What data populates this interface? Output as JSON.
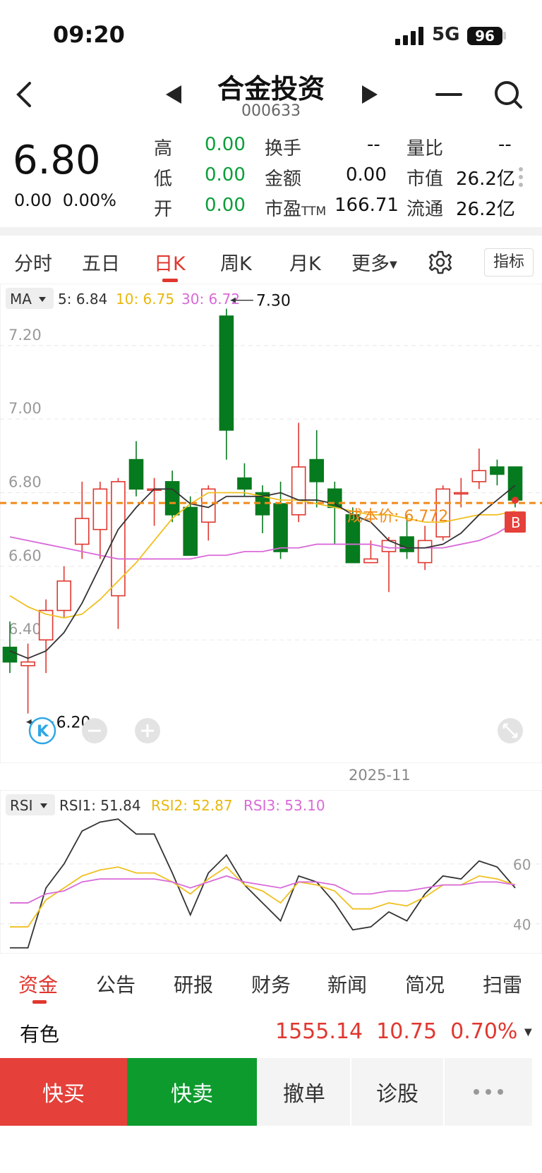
{
  "status": {
    "time": "09:20",
    "network": "5G",
    "battery": "96"
  },
  "nav": {
    "name": "合金投资",
    "code": "000633"
  },
  "quote": {
    "price": "6.80",
    "change": "0.00",
    "change_pct": "0.00%",
    "grid": [
      [
        {
          "k": "高",
          "v": "0.00"
        },
        {
          "k": "换手",
          "v": "--"
        },
        {
          "k": "量比",
          "v": "--"
        }
      ],
      [
        {
          "k": "低",
          "v": "0.00"
        },
        {
          "k": "金额",
          "v": "0.00"
        },
        {
          "k": "市值",
          "v": "26.2亿"
        }
      ],
      [
        {
          "k": "开",
          "v": "0.00"
        },
        {
          "k": "市盈",
          "sub": "TTM",
          "v": "166.71"
        },
        {
          "k": "流通",
          "v": "26.2亿"
        }
      ]
    ]
  },
  "tabs": [
    "分时",
    "五日",
    "日K",
    "周K",
    "月K",
    "更多"
  ],
  "active_tab": "日K",
  "indicator_btn": "指标",
  "ma_legend": {
    "selector": "MA",
    "ma5": "5: 6.84",
    "ma10": "10: 6.75",
    "ma30": "30: 6.72"
  },
  "chart_annotations": {
    "high": "7.30",
    "low": "6.20",
    "cost": "成本价: 6.772",
    "buy_marker": "B",
    "k_marker": "K"
  },
  "date_label": "2025-11",
  "rsi_legend": {
    "selector": "RSI",
    "rsi1": "RSI1: 51.84",
    "rsi2": "RSI2: 52.87",
    "rsi3": "RSI3: 53.10"
  },
  "colors": {
    "up": "#e0372f",
    "down": "#067a1e",
    "ma5": "#333333",
    "ma10": "#f0c020",
    "ma30": "#d96ad9",
    "cost": "#f08a1c"
  },
  "chart_data": [
    {
      "type": "candlestick",
      "y_ticks": [
        "7.20",
        "7.00",
        "6.80",
        "6.60",
        "6.40"
      ],
      "ylim": [
        6.18,
        7.33
      ],
      "candles": [
        {
          "o": 6.38,
          "c": 6.34,
          "h": 6.45,
          "l": 6.31
        },
        {
          "o": 6.33,
          "c": 6.34,
          "h": 6.39,
          "l": 6.2
        },
        {
          "o": 6.4,
          "c": 6.48,
          "h": 6.51,
          "l": 6.31
        },
        {
          "o": 6.48,
          "c": 6.56,
          "h": 6.6,
          "l": 6.46
        },
        {
          "o": 6.66,
          "c": 6.73,
          "h": 6.83,
          "l": 6.62
        },
        {
          "o": 6.7,
          "c": 6.81,
          "h": 6.83,
          "l": 6.62
        },
        {
          "o": 6.52,
          "c": 6.83,
          "h": 6.84,
          "l": 6.43
        },
        {
          "o": 6.89,
          "c": 6.81,
          "h": 6.94,
          "l": 6.79
        },
        {
          "o": 6.81,
          "c": 6.81,
          "h": 6.84,
          "l": 6.71
        },
        {
          "o": 6.83,
          "c": 6.74,
          "h": 6.86,
          "l": 6.72
        },
        {
          "o": 6.76,
          "c": 6.63,
          "h": 6.79,
          "l": 6.63
        },
        {
          "o": 6.72,
          "c": 6.81,
          "h": 6.82,
          "l": 6.67
        },
        {
          "o": 7.28,
          "c": 6.97,
          "h": 7.3,
          "l": 6.89
        },
        {
          "o": 6.84,
          "c": 6.81,
          "h": 6.88,
          "l": 6.79
        },
        {
          "o": 6.8,
          "c": 6.74,
          "h": 6.82,
          "l": 6.69
        },
        {
          "o": 6.77,
          "c": 6.64,
          "h": 6.83,
          "l": 6.62
        },
        {
          "o": 6.74,
          "c": 6.87,
          "h": 6.99,
          "l": 6.72
        },
        {
          "o": 6.89,
          "c": 6.83,
          "h": 6.97,
          "l": 6.76
        },
        {
          "o": 6.81,
          "c": 6.76,
          "h": 6.83,
          "l": 6.66
        },
        {
          "o": 6.74,
          "c": 6.61,
          "h": 6.76,
          "l": 6.61
        },
        {
          "o": 6.61,
          "c": 6.62,
          "h": 6.67,
          "l": 6.61
        },
        {
          "o": 6.64,
          "c": 6.67,
          "h": 6.68,
          "l": 6.53
        },
        {
          "o": 6.68,
          "c": 6.64,
          "h": 6.74,
          "l": 6.62
        },
        {
          "o": 6.61,
          "c": 6.67,
          "h": 6.71,
          "l": 6.59
        },
        {
          "o": 6.68,
          "c": 6.81,
          "h": 6.82,
          "l": 6.67
        },
        {
          "o": 6.8,
          "c": 6.8,
          "h": 6.84,
          "l": 6.76
        },
        {
          "o": 6.83,
          "c": 6.86,
          "h": 6.92,
          "l": 6.81
        },
        {
          "o": 6.87,
          "c": 6.85,
          "h": 6.89,
          "l": 6.82
        },
        {
          "o": 6.87,
          "c": 6.78,
          "h": 6.87,
          "l": 6.76
        }
      ],
      "ma5": [
        6.37,
        6.35,
        6.37,
        6.42,
        6.5,
        6.6,
        6.7,
        6.76,
        6.81,
        6.81,
        6.77,
        6.76,
        6.79,
        6.79,
        6.79,
        6.8,
        6.78,
        6.78,
        6.77,
        6.74,
        6.72,
        6.67,
        6.65,
        6.65,
        6.66,
        6.69,
        6.74,
        6.78,
        6.82
      ],
      "ma10": [
        6.52,
        6.49,
        6.47,
        6.46,
        6.47,
        6.51,
        6.56,
        6.61,
        6.67,
        6.73,
        6.77,
        6.8,
        6.8,
        6.8,
        6.79,
        6.78,
        6.78,
        6.77,
        6.76,
        6.75,
        6.74,
        6.74,
        6.73,
        6.72,
        6.72,
        6.73,
        6.74,
        6.74,
        6.75
      ],
      "ma30": [
        6.68,
        6.67,
        6.66,
        6.65,
        6.64,
        6.63,
        6.62,
        6.62,
        6.62,
        6.62,
        6.62,
        6.63,
        6.63,
        6.64,
        6.64,
        6.65,
        6.65,
        6.66,
        6.66,
        6.66,
        6.66,
        6.65,
        6.65,
        6.65,
        6.65,
        6.66,
        6.67,
        6.69,
        6.72
      ],
      "cost_line": 6.772
    },
    {
      "type": "line",
      "y_ticks": [
        "60",
        "40"
      ],
      "ylim": [
        31,
        80
      ],
      "series": [
        {
          "name": "RSI1",
          "values": [
            32,
            32,
            52,
            60,
            71,
            74,
            75,
            70,
            70,
            57,
            43,
            57,
            63,
            53,
            47,
            41,
            56,
            54,
            47,
            38,
            39,
            44,
            41,
            50,
            56,
            55,
            61,
            59,
            52
          ]
        },
        {
          "name": "RSI2",
          "values": [
            39,
            39,
            48,
            52,
            56,
            58,
            59,
            57,
            57,
            54,
            50,
            55,
            59,
            53,
            51,
            47,
            54,
            53,
            51,
            45,
            45,
            47,
            46,
            49,
            53,
            53,
            56,
            55,
            53
          ]
        },
        {
          "name": "RSI3",
          "values": [
            47,
            47,
            50,
            51,
            54,
            55,
            55,
            55,
            55,
            54,
            52,
            54,
            56,
            54,
            53,
            52,
            54,
            54,
            53,
            50,
            50,
            51,
            51,
            52,
            53,
            53,
            54,
            54,
            53
          ]
        }
      ]
    }
  ],
  "rsi_ticks": [
    "60",
    "40"
  ],
  "bottom_tabs": [
    "资金",
    "公告",
    "研报",
    "财务",
    "新闻",
    "简况",
    "扫雷"
  ],
  "active_bottom_tab": "资金",
  "sector": {
    "name": "有色",
    "index": "1555.14",
    "change": "10.75",
    "pct": "0.70%"
  },
  "actions": [
    "快买",
    "快卖",
    "撤单",
    "诊股"
  ]
}
